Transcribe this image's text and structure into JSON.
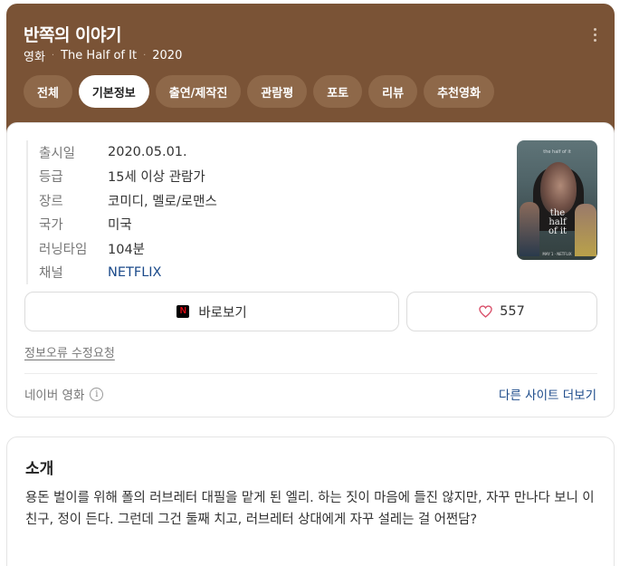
{
  "header": {
    "title": "반쪽의 이야기",
    "subtitle": {
      "type": "영화",
      "original_title": "The Half of It",
      "year": "2020"
    },
    "separator": "·",
    "more_icon": "more-vertical-icon",
    "bg_color": "#7a5336"
  },
  "tabs": [
    {
      "label": "전체",
      "active": false
    },
    {
      "label": "기본정보",
      "active": true
    },
    {
      "label": "출연/제작진",
      "active": false
    },
    {
      "label": "관람평",
      "active": false
    },
    {
      "label": "포토",
      "active": false
    },
    {
      "label": "리뷰",
      "active": false
    },
    {
      "label": "추천영화",
      "active": false
    }
  ],
  "info": {
    "rows": [
      {
        "key": "출시일",
        "value": "2020.05.01."
      },
      {
        "key": "등급",
        "value": "15세 이상 관람가"
      },
      {
        "key": "장르",
        "value": "코미디, 멜로/로맨스"
      },
      {
        "key": "국가",
        "value": "미국"
      },
      {
        "key": "러닝타임",
        "value": "104분"
      },
      {
        "key": "채널",
        "value": "NETFLIX"
      }
    ]
  },
  "poster": {
    "tagline": "the half of it",
    "title_lines": [
      "the",
      "half",
      "of it"
    ],
    "date": "MAY 1 · NETFLIX"
  },
  "actions": {
    "watch_label": "바로보기",
    "watch_icon": "netflix-icon",
    "like_count": "557",
    "like_icon": "heart-icon"
  },
  "error_report": "정보오류 수정요청",
  "footer": {
    "source": "네이버 영화",
    "source_icon": "info-icon",
    "more_sites": "다른 사이트 더보기"
  },
  "intro": {
    "title": "소개",
    "text": "용돈 벌이를 위해 폴의 러브레터 대필을 맡게 된 엘리. 하는 짓이 마음에 들진 않지만, 자꾸 만나다 보니 이 친구, 정이 든다. 그런데 그건 둘째 치고, 러브레터 상대에게 자꾸 설레는 걸 어쩐담?"
  },
  "colors": {
    "link": "#1b4a8a",
    "netflix_red": "#e50914",
    "heart": "#d9506a"
  }
}
